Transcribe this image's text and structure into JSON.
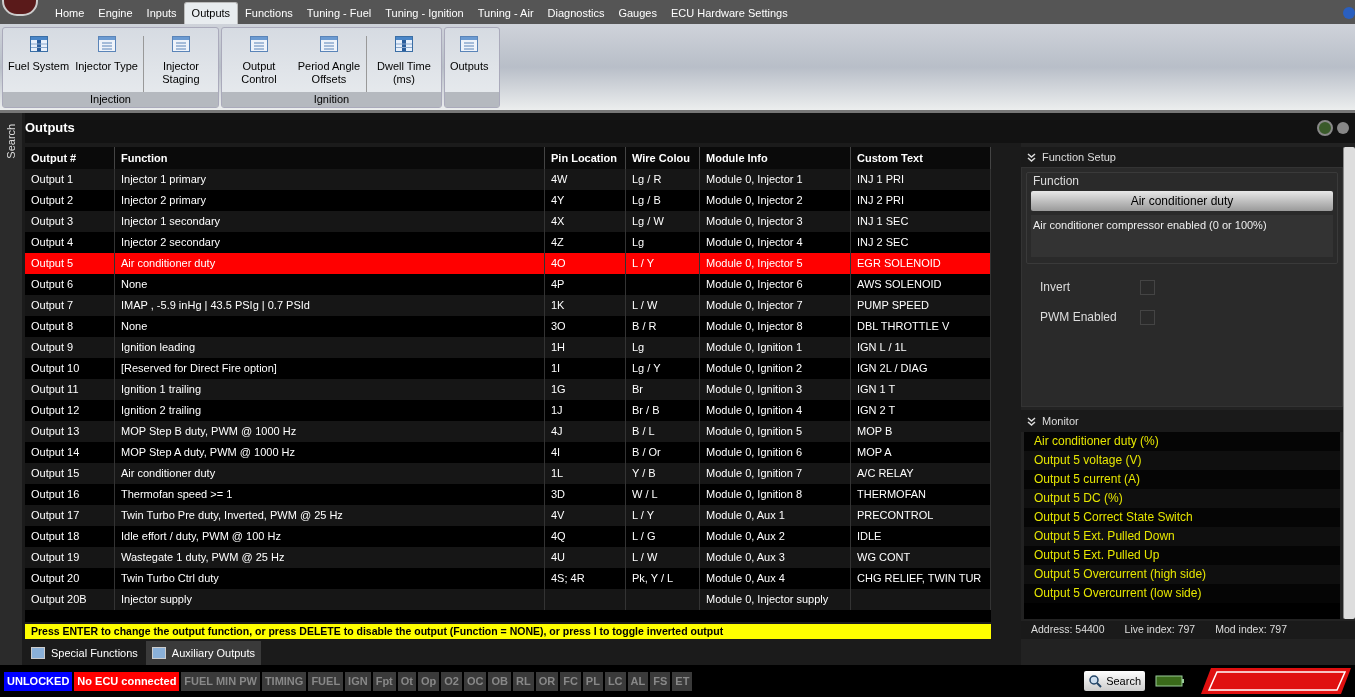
{
  "menu_tabs": [
    {
      "label": "Home",
      "selected": false
    },
    {
      "label": "Engine",
      "selected": false
    },
    {
      "label": "Inputs",
      "selected": false
    },
    {
      "label": "Outputs",
      "selected": true
    },
    {
      "label": "Functions",
      "selected": false
    },
    {
      "label": "Tuning - Fuel",
      "selected": false
    },
    {
      "label": "Tuning - Ignition",
      "selected": false
    },
    {
      "label": "Tuning - Air",
      "selected": false
    },
    {
      "label": "Diagnostics",
      "selected": false
    },
    {
      "label": "Gauges",
      "selected": false
    },
    {
      "label": "ECU Hardware Settings",
      "selected": false
    }
  ],
  "ribbon": [
    {
      "label": "Injection",
      "buttons": [
        {
          "label": "Fuel System",
          "kind": "grid"
        },
        {
          "label": "Injector Type",
          "kind": "list"
        },
        {
          "label": "Injector Staging",
          "kind": "list",
          "separated": true
        }
      ]
    },
    {
      "label": "Ignition",
      "buttons": [
        {
          "label": "Output Control",
          "kind": "list"
        },
        {
          "label": "Period Angle Offsets",
          "kind": "list"
        },
        {
          "label": "Dwell Time (ms)",
          "kind": "grid",
          "separated": true
        }
      ]
    },
    {
      "buttons": [
        {
          "label": "Outputs",
          "kind": "list"
        }
      ]
    }
  ],
  "side_tab": "Search",
  "panel_title": "Outputs",
  "table": {
    "columns": [
      "Output #",
      "Function",
      "Pin Location",
      "Wire Colou",
      "Module Info",
      "Custom Text"
    ],
    "rows": [
      {
        "cells": [
          "Output 1",
          "Injector 1 primary",
          "4W",
          "Lg / R",
          "Module 0, Injector 1",
          "INJ 1 PRI"
        ],
        "selected": false
      },
      {
        "cells": [
          "Output 2",
          "Injector 2 primary",
          "4Y",
          "Lg / B",
          "Module 0, Injector 2",
          "INJ 2 PRI"
        ],
        "selected": false
      },
      {
        "cells": [
          "Output 3",
          "Injector 1 secondary",
          "4X",
          "Lg / W",
          "Module 0, Injector 3",
          "INJ 1 SEC"
        ],
        "selected": false
      },
      {
        "cells": [
          "Output 4",
          "Injector 2 secondary",
          "4Z",
          "Lg",
          "Module 0, Injector 4",
          "INJ 2 SEC"
        ],
        "selected": false
      },
      {
        "cells": [
          "Output 5",
          "Air conditioner duty",
          "4O",
          "L / Y",
          "Module 0, Injector 5",
          "EGR SOLENOID"
        ],
        "selected": true
      },
      {
        "cells": [
          "Output 6",
          "None",
          "4P",
          "",
          "Module 0, Injector 6",
          "AWS SOLENOID"
        ],
        "selected": false
      },
      {
        "cells": [
          "Output 7",
          "IMAP , -5.9 inHg | 43.5 PSIg | 0.7 PSId",
          "1K",
          "L / W",
          "Module 0, Injector 7",
          "PUMP SPEED"
        ],
        "selected": false
      },
      {
        "cells": [
          "Output 8",
          "None",
          "3O",
          "B / R",
          "Module 0, Injector 8",
          "DBL THROTTLE V"
        ],
        "selected": false
      },
      {
        "cells": [
          "Output 9",
          "Ignition leading",
          "1H",
          "Lg",
          "Module 0, Ignition 1",
          "IGN L / 1L"
        ],
        "selected": false
      },
      {
        "cells": [
          "Output 10",
          "[Reserved for Direct Fire option]",
          "1I",
          "Lg / Y",
          "Module 0, Ignition 2",
          "IGN 2L / DIAG"
        ],
        "selected": false
      },
      {
        "cells": [
          "Output 11",
          "Ignition 1 trailing",
          "1G",
          "Br",
          "Module 0, Ignition 3",
          "IGN 1 T"
        ],
        "selected": false
      },
      {
        "cells": [
          "Output 12",
          "Ignition 2 trailing",
          "1J",
          "Br / B",
          "Module 0, Ignition 4",
          "IGN 2 T"
        ],
        "selected": false
      },
      {
        "cells": [
          "Output 13",
          "MOP Step B duty, PWM @ 1000 Hz",
          "4J",
          "B / L",
          "Module 0, Ignition 5",
          "MOP B"
        ],
        "selected": false
      },
      {
        "cells": [
          "Output 14",
          "MOP Step A duty, PWM @ 1000 Hz",
          "4I",
          "B / Or",
          "Module 0, Ignition 6",
          "MOP A"
        ],
        "selected": false
      },
      {
        "cells": [
          "Output 15",
          "Air conditioner duty",
          "1L",
          "Y / B",
          "Module 0, Ignition 7",
          "A/C RELAY"
        ],
        "selected": false
      },
      {
        "cells": [
          "Output 16",
          "Thermofan speed >= 1",
          "3D",
          "W / L",
          "Module 0, Ignition 8",
          "THERMOFAN"
        ],
        "selected": false
      },
      {
        "cells": [
          "Output 17",
          "Twin Turbo Pre duty, Inverted, PWM @ 25 Hz",
          "4V",
          "L / Y",
          "Module 0, Aux 1",
          "PRECONTROL"
        ],
        "selected": false
      },
      {
        "cells": [
          "Output 18",
          "Idle effort / duty, PWM @ 100 Hz",
          "4Q",
          "L / G",
          "Module 0, Aux 2",
          "IDLE"
        ],
        "selected": false
      },
      {
        "cells": [
          "Output 19",
          "Wastegate 1 duty, PWM @ 25 Hz",
          "4U",
          "L / W",
          "Module 0, Aux 3",
          "WG CONT"
        ],
        "selected": false
      },
      {
        "cells": [
          "Output 20",
          "Twin Turbo Ctrl duty",
          "4S; 4R",
          "Pk, Y / L",
          "Module 0, Aux 4",
          "CHG RELIEF, TWIN TUR"
        ],
        "selected": false
      },
      {
        "cells": [
          "Output 20B",
          "Injector supply",
          "",
          "",
          "Module 0, Injector supply",
          ""
        ],
        "selected": false
      }
    ]
  },
  "hint": "Press ENTER to change the output function, or press DELETE to disable the output (Function = NONE), or press I to toggle inverted output",
  "bottom_tabs": [
    {
      "label": "Special Functions",
      "selected": false
    },
    {
      "label": "Auxiliary Outputs",
      "selected": true
    }
  ],
  "function_setup": {
    "title": "Function Setup",
    "group": "Function",
    "button": "Air conditioner duty",
    "description": "Air conditioner compressor enabled (0 or 100%)",
    "options": [
      {
        "label": "Invert",
        "checked": false
      },
      {
        "label": "PWM Enabled",
        "checked": false
      }
    ]
  },
  "monitor": {
    "title": "Monitor",
    "items": [
      "Air conditioner duty (%)",
      "Output 5 voltage (V)",
      "Output 5 current (A)",
      "Output 5  DC (%)",
      "Output 5 Correct State Switch",
      "Output 5 Ext. Pulled Down",
      "Output 5 Ext. Pulled Up",
      "Output 5  Overcurrent (high side)",
      "Output 5  Overcurrent (low side)"
    ]
  },
  "address_bar": [
    "Address: 54400",
    "Live index: 797",
    "Mod index: 797"
  ],
  "status_tags": [
    {
      "label": "UNLOCKED",
      "color": "#0000ff"
    },
    {
      "label": "No ECU connected",
      "color": "#ff0000"
    },
    {
      "label": "FUEL MIN PW",
      "color": "#3a3a3a"
    },
    {
      "label": "TIMING",
      "color": "#3a3a3a"
    },
    {
      "label": "FUEL",
      "color": "#3a3a3a"
    },
    {
      "label": "IGN",
      "color": "#3a3a3a"
    },
    {
      "label": "Fpt",
      "color": "#3a3a3a"
    },
    {
      "label": "Ot",
      "color": "#3a3a3a"
    },
    {
      "label": "Op",
      "color": "#3a3a3a"
    },
    {
      "label": "O2",
      "color": "#3a3a3a"
    },
    {
      "label": "OC",
      "color": "#3a3a3a"
    },
    {
      "label": "OB",
      "color": "#3a3a3a"
    },
    {
      "label": "RL",
      "color": "#3a3a3a"
    },
    {
      "label": "OR",
      "color": "#3a3a3a"
    },
    {
      "label": "FC",
      "color": "#3a3a3a"
    },
    {
      "label": "PL",
      "color": "#3a3a3a"
    },
    {
      "label": "LC",
      "color": "#3a3a3a"
    },
    {
      "label": "AL",
      "color": "#3a3a3a"
    },
    {
      "label": "FS",
      "color": "#3a3a3a"
    },
    {
      "label": "ET",
      "color": "#3a3a3a"
    }
  ],
  "search_button": "Search"
}
